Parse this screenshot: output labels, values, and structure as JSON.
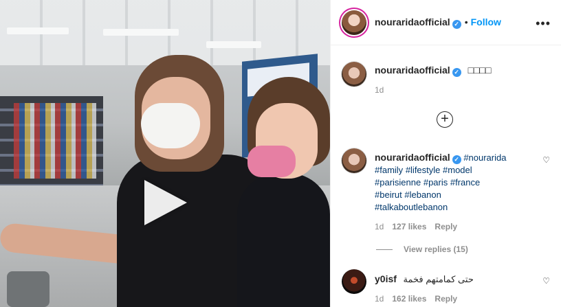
{
  "account": {
    "username": "nouraridaofficial",
    "verified_mark": "✓",
    "separator": "•",
    "follow_label": "Follow",
    "more_icon": "•••"
  },
  "post_caption": {
    "username": "nouraridaofficial",
    "text": "□□□□",
    "time": "1d"
  },
  "load_more_icon": "+",
  "comments": [
    {
      "username": "nouraridaofficial",
      "hashtags_line1": "#nourarida",
      "hashtags_line2": [
        "#family",
        "#lifestyle",
        "#model"
      ],
      "hashtags_line3": [
        "#parisienne",
        "#paris",
        "#france"
      ],
      "hashtags_line4": [
        "#beirut",
        "#lebanon"
      ],
      "hashtags_line5": "#talkaboutlebanon",
      "time": "1d",
      "likes": "127 likes",
      "reply_label": "Reply",
      "view_replies": "View replies (15)",
      "heart_icon": "♡"
    },
    {
      "username": "y0isf",
      "text": "حتى كمامتهم فخمة",
      "time": "1d",
      "likes": "162 likes",
      "reply_label": "Reply",
      "heart_icon": "♡"
    }
  ],
  "colors": {
    "link": "#0095f6",
    "hashtag": "#00376b",
    "muted": "#8e8e8e"
  }
}
